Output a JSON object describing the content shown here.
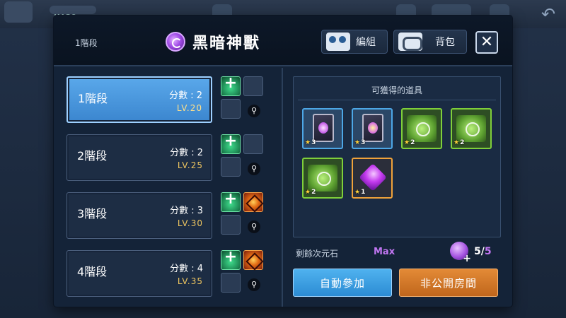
{
  "header": {
    "current_stage": "1階段",
    "title": "黑暗神獸",
    "team_label": "編組",
    "bag_label": "背包",
    "close_label": "✕"
  },
  "stages": [
    {
      "name": "1階段",
      "score": "分數 : 2",
      "level": "LV.20",
      "selected": true,
      "slots": [
        "buff",
        "empty"
      ]
    },
    {
      "name": "2階段",
      "score": "分數 : 2",
      "level": "LV.25",
      "selected": false,
      "slots": [
        "buff",
        "empty"
      ]
    },
    {
      "name": "3階段",
      "score": "分數 : 3",
      "level": "LV.30",
      "selected": false,
      "slots": [
        "buff",
        "fire"
      ]
    },
    {
      "name": "4階段",
      "score": "分數 : 4",
      "level": "LV.35",
      "selected": false,
      "slots": [
        "buff",
        "fire"
      ]
    }
  ],
  "drops": {
    "title": "可獲得的道具",
    "items": [
      {
        "kind": "card",
        "frame": "blue",
        "stars": "3"
      },
      {
        "kind": "card-gold",
        "frame": "blue",
        "stars": "3"
      },
      {
        "kind": "material",
        "frame": "green",
        "stars": "2"
      },
      {
        "kind": "material",
        "frame": "green",
        "stars": "2"
      },
      {
        "kind": "material",
        "frame": "green",
        "stars": "2"
      },
      {
        "kind": "gem",
        "frame": "orange",
        "stars": "1"
      }
    ]
  },
  "remaining": {
    "label": "剩餘次元石",
    "max_label": "Max",
    "current": "5",
    "separator": "/",
    "total": "5"
  },
  "actions": {
    "auto_join": "自動參加",
    "private_room": "非公開房間"
  },
  "hud": {
    "level": "LV.20"
  }
}
